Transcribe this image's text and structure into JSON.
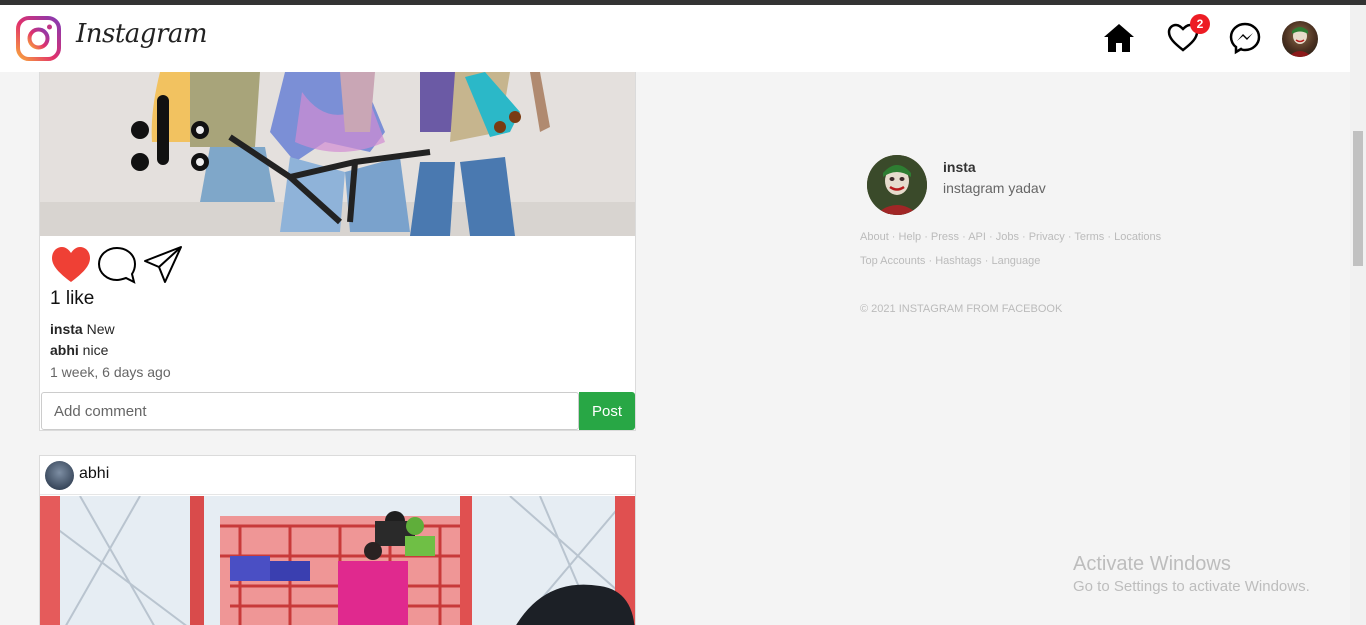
{
  "navbar": {
    "brand": "Instagram",
    "notification_count": "2",
    "icons": [
      "instagram-logo-icon",
      "home-icon",
      "heart-icon",
      "messenger-icon"
    ]
  },
  "feed": {
    "post1": {
      "likes": "1 like",
      "captions": [
        {
          "user": "insta",
          "text": "New"
        },
        {
          "user": "abhi",
          "text": "nice"
        }
      ],
      "time": "1 week, 6 days ago",
      "comment_placeholder": "Add comment",
      "post_label": "Post",
      "liked": true
    },
    "post2": {
      "username": "abhi"
    }
  },
  "sidebar": {
    "username": "insta",
    "fullname": "instagram yadav",
    "footer_links_1": "About · Help · Press · API · Jobs · Privacy · Terms · Locations",
    "footer_links_2": "Top Accounts · Hashtags · Language",
    "copyright": "© 2021 INSTAGRAM FROM FACEBOOK"
  },
  "watermark": {
    "title": "Activate Windows",
    "subtitle": "Go to Settings to activate Windows."
  },
  "colors": {
    "like_red": "#ef4035",
    "post_button_green": "#28a745",
    "badge_red": "#ed1c24"
  }
}
